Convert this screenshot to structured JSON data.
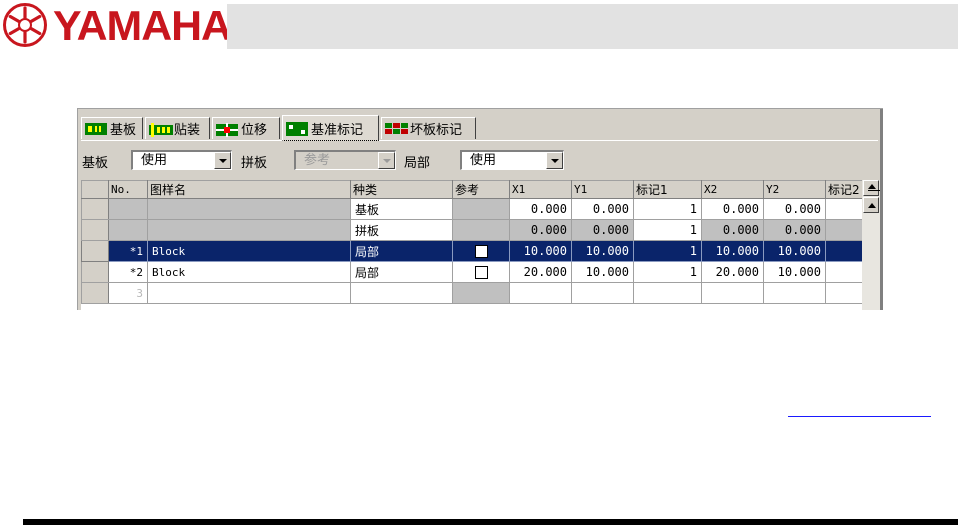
{
  "brand": {
    "logo_text": "YAMAHA",
    "logo_color": "#c8161e",
    "emblem_icon": "tuning-fork-emblem-icon"
  },
  "tabs": [
    {
      "label": "基板",
      "icon": "board-icon",
      "active": false
    },
    {
      "label": "贴装",
      "icon": "mount-icon",
      "active": false
    },
    {
      "label": "位移",
      "icon": "offset-icon",
      "active": false
    },
    {
      "label": "基准标记",
      "icon": "fiducial-mark-icon",
      "active": true
    },
    {
      "label": "坏板标记",
      "icon": "bad-mark-icon",
      "active": false
    }
  ],
  "filters": {
    "board_label": "基板",
    "board_value": "使用",
    "panel_label": "拼板",
    "panel_value": "参考",
    "local_label": "局部",
    "local_value": "使用"
  },
  "grid": {
    "columns": [
      "No.",
      "图样名",
      "种类",
      "参考",
      "X1",
      "Y1",
      "标记1",
      "X2",
      "Y2",
      "标记2"
    ],
    "rows": [
      {
        "no": "",
        "name": "",
        "type": "基板",
        "ref": false,
        "x1": "0.000",
        "y1": "0.000",
        "mark1": "1",
        "x2": "0.000",
        "y2": "0.000",
        "mark2": ""
      },
      {
        "no": "",
        "name": "",
        "type": "拼板",
        "ref": false,
        "x1": "0.000",
        "y1": "0.000",
        "mark1": "1",
        "x2": "0.000",
        "y2": "0.000",
        "mark2": ""
      },
      {
        "no": "*1",
        "name": "Block",
        "type": "局部",
        "ref": true,
        "x1": "10.000",
        "y1": "10.000",
        "mark1": "1",
        "x2": "10.000",
        "y2": "10.000",
        "mark2": ""
      },
      {
        "no": "*2",
        "name": "Block",
        "type": "局部",
        "ref": true,
        "x1": "20.000",
        "y1": "10.000",
        "mark1": "1",
        "x2": "20.000",
        "y2": "10.000",
        "mark2": ""
      },
      {
        "no": "3",
        "name": "",
        "type": "",
        "ref": false,
        "x1": "",
        "y1": "",
        "mark1": "",
        "x2": "",
        "y2": "",
        "mark2": ""
      }
    ],
    "selected_row_color": "#0a246a"
  }
}
